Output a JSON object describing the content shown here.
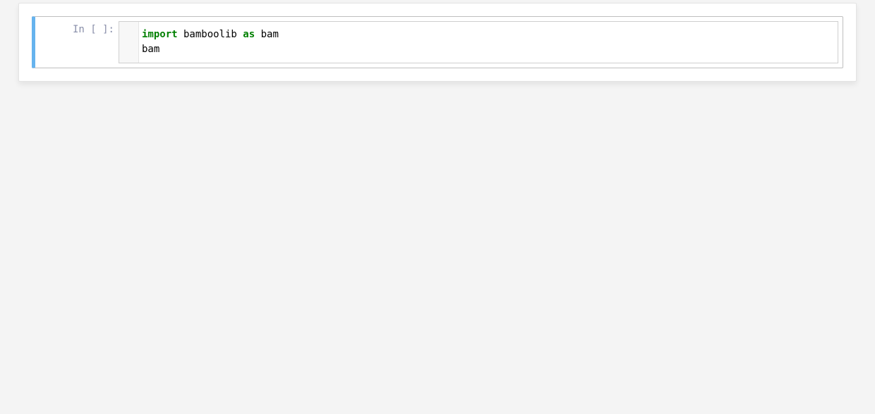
{
  "cell": {
    "prompt": "In [ ]:",
    "code": {
      "line1_kw1": "import",
      "line1_name": " bamboolib ",
      "line1_kw2": "as",
      "line1_alias": " bam",
      "line2": "bam"
    }
  }
}
